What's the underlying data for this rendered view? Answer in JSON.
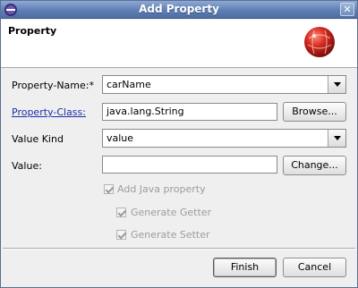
{
  "window": {
    "title": "Add Property",
    "close_glyph": "✕"
  },
  "banner": {
    "title": "Property",
    "logo_icon": "red-sphere-logo-icon"
  },
  "form": {
    "property_name": {
      "label": "Property-Name:*",
      "value": "carName"
    },
    "property_class": {
      "label": "Property-Class:",
      "value": "java.lang.String",
      "button": "Browse..."
    },
    "value_kind": {
      "label": "Value Kind",
      "value": "value"
    },
    "value": {
      "label": "Value:",
      "value": "",
      "button": "Change..."
    },
    "add_java_property": {
      "label": "Add Java property",
      "checked": true
    },
    "generate_getter": {
      "label": "Generate Getter",
      "checked": true
    },
    "generate_setter": {
      "label": "Generate Setter",
      "checked": true
    }
  },
  "buttons": {
    "finish": "Finish",
    "cancel": "Cancel"
  },
  "colors": {
    "titlebar": "#5f7fb5",
    "link": "#1a2ea8",
    "disabled_text": "#9c9c9c"
  }
}
